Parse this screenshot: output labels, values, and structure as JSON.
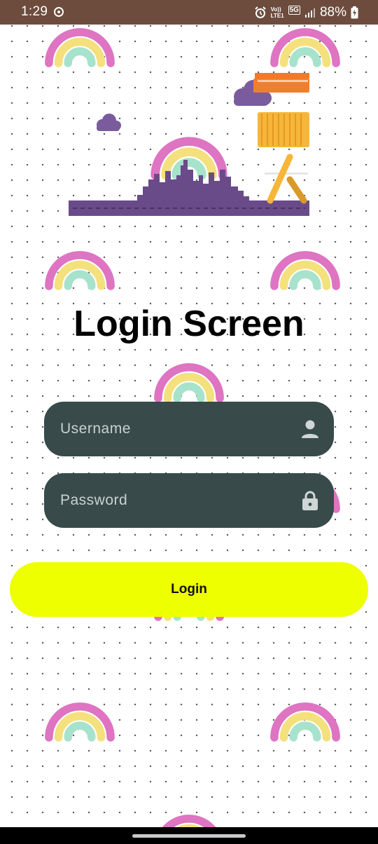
{
  "status_bar": {
    "time": "1:29",
    "network_label_top": "Vo))",
    "network_label_bottom": "LTE1",
    "network_type": "5G",
    "battery": "88%",
    "icons": [
      "sync-icon",
      "alarm-icon",
      "signal-icon",
      "battery-charging-icon"
    ]
  },
  "screen": {
    "title": "Login Screen"
  },
  "username_field": {
    "placeholder": "Username",
    "value": "",
    "icon": "person-icon"
  },
  "password_field": {
    "placeholder": "Password",
    "value": "",
    "icon": "lock-icon"
  },
  "login_button": {
    "label": "Login"
  },
  "colors": {
    "status_bar": "#6d4c3d",
    "field_background": "#384a4a",
    "button_background": "#eeff00",
    "rainbow_pink": "#de74c2",
    "rainbow_yellow": "#f4e07d",
    "rainbow_mint": "#a7e3cc",
    "skyline_purple": "#6a4b8a"
  }
}
